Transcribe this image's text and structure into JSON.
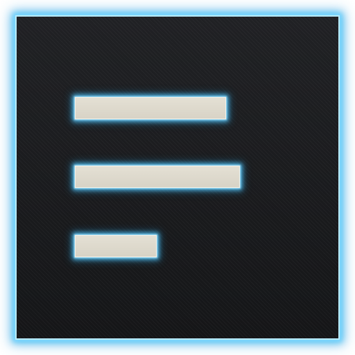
{
  "icon": {
    "name": "text-align-left-icon",
    "colors": {
      "background": "#1b1c1e",
      "glow": "#41bef5",
      "bar_fill": "#ddd9cd"
    },
    "lines": [
      {
        "name": "line-long"
      },
      {
        "name": "line-longest"
      },
      {
        "name": "line-short"
      }
    ]
  }
}
